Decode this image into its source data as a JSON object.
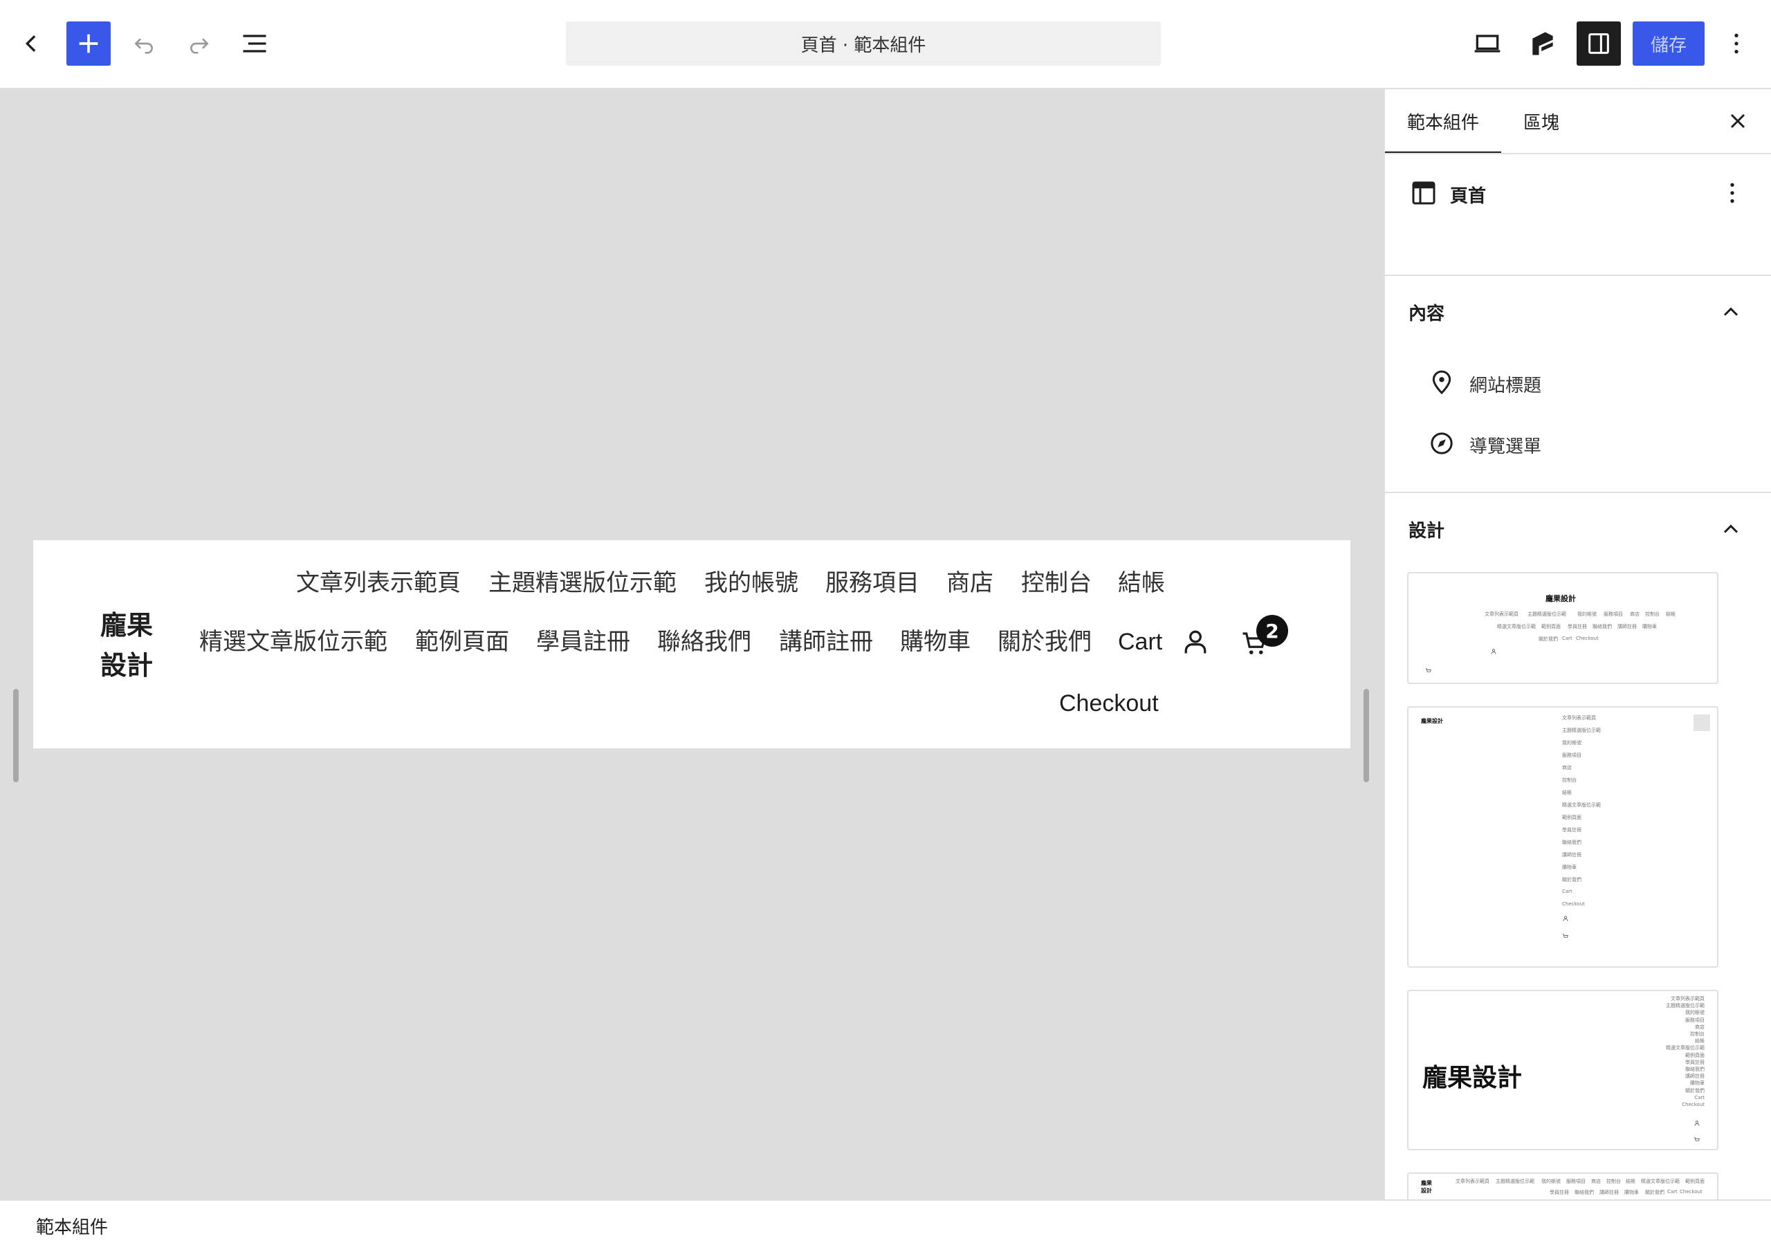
{
  "toolbar": {
    "document_title": "頁首 · 範本組件",
    "save_label": "儲存"
  },
  "canvas": {
    "site_title": "龐果設計",
    "nav_row1": [
      "文章列表示範頁",
      "主題精選版位示範",
      "我的帳號",
      "服務項目",
      "商店",
      "控制台",
      "結帳"
    ],
    "nav_row2": [
      "精選文章版位示範",
      "範例頁面",
      "學員註冊",
      "聯絡我們",
      "講師註冊",
      "購物車",
      "關於我們",
      "Cart"
    ],
    "nav_row3": [
      "Checkout"
    ],
    "cart_count": "2"
  },
  "sidebar": {
    "tabs": [
      "範本組件",
      "區塊"
    ],
    "template_part_name": "頁首",
    "content_title": "內容",
    "content_items": [
      "網站標題",
      "導覽選單"
    ],
    "design_title": "設計",
    "preview": {
      "site_title": "龐果設計",
      "nav_items": [
        "文章列表示範頁",
        "主題精選版位示範",
        "我的帳號",
        "服務項目",
        "商店",
        "控制台",
        "結帳",
        "精選文章版位示範",
        "範例頁面",
        "學員註冊",
        "聯絡我們",
        "講師註冊",
        "購物車",
        "關於我們",
        "Cart",
        "Checkout"
      ]
    }
  },
  "footer": {
    "breadcrumb": "範本組件"
  },
  "colors": {
    "accent": "#3858e9",
    "dark": "#1e1e1e",
    "canvas_bg": "#dddddd"
  }
}
